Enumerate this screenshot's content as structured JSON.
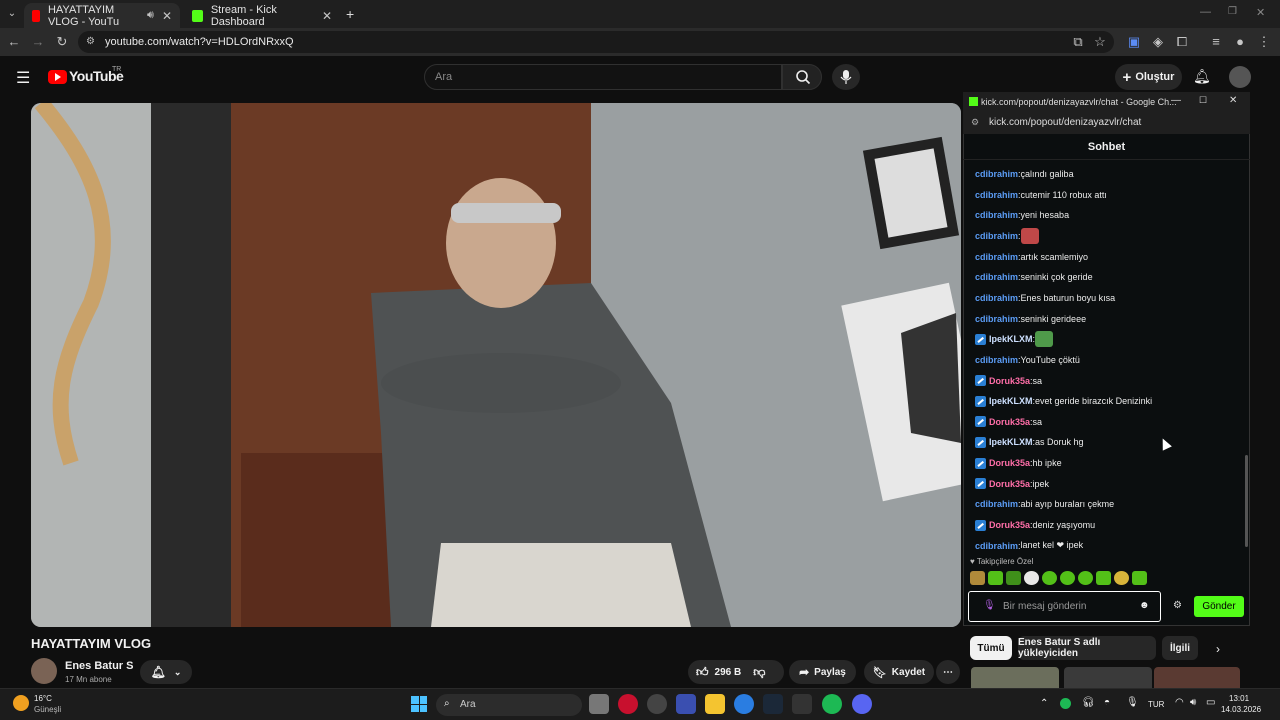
{
  "browser": {
    "tabs": [
      {
        "title": "HAYATTAYIM VLOG - YouTu",
        "active": true
      },
      {
        "title": "Stream - Kick Dashboard",
        "active": false
      }
    ],
    "url": "youtube.com/watch?v=HDLOrdNRxxQ"
  },
  "youtube": {
    "logo": "YouTube",
    "region": "TR",
    "search_placeholder": "Ara",
    "create_label": "Oluştur",
    "video_title": "HAYATTAYIM VLOG",
    "channel_name": "Enes Batur S",
    "subscribers": "17 Mn abone",
    "likes": "296 B",
    "share_label": "Paylaş",
    "save_label": "Kaydet",
    "filter_chips": [
      "Tümü",
      "Enes Batur S adlı yükleyiciden",
      "İlgili"
    ]
  },
  "popup": {
    "window_title": "kick.com/popout/denizayazvlr/chat - Google Ch...",
    "url": "kick.com/popout/denizayazvlr/chat",
    "header": "Sohbet",
    "messages": [
      {
        "user": "cdibrahim",
        "text": "çalındı galiba",
        "color": "#5b9cf5",
        "badge": false
      },
      {
        "user": "cdibrahim",
        "text": "cutemir 110 robux attı",
        "color": "#5b9cf5",
        "badge": false
      },
      {
        "user": "cdibrahim",
        "text": "yeni hesaba",
        "color": "#5b9cf5",
        "badge": false
      },
      {
        "user": "cdibrahim",
        "text": "",
        "color": "#5b9cf5",
        "badge": false,
        "emote": true
      },
      {
        "user": "cdibrahim",
        "text": "artık scamlemiyo",
        "color": "#5b9cf5",
        "badge": false
      },
      {
        "user": "cdibrahim",
        "text": "seninki çok geride",
        "color": "#5b9cf5",
        "badge": false
      },
      {
        "user": "cdibrahim",
        "text": "Enes baturun boyu kısa",
        "color": "#5b9cf5",
        "badge": false
      },
      {
        "user": "cdibrahim",
        "text": "seninki gerideee",
        "color": "#5b9cf5",
        "badge": false
      },
      {
        "user": "IpekKLXM",
        "text": "",
        "color": "#cde0ff",
        "badge": true,
        "emote": true
      },
      {
        "user": "cdibrahim",
        "text": "YouTube çöktü",
        "color": "#5b9cf5",
        "badge": false
      },
      {
        "user": "Doruk35a",
        "text": "sa",
        "color": "#ff6ea8",
        "badge": true
      },
      {
        "user": "IpekKLXM",
        "text": "evet geride birazcık Denizinki",
        "color": "#cde0ff",
        "badge": true
      },
      {
        "user": "Doruk35a",
        "text": "sa",
        "color": "#ff6ea8",
        "badge": true
      },
      {
        "user": "IpekKLXM",
        "text": "as Doruk hg",
        "color": "#cde0ff",
        "badge": true
      },
      {
        "user": "Doruk35a",
        "text": "hb ipke",
        "color": "#ff6ea8",
        "badge": true
      },
      {
        "user": "Doruk35a",
        "text": "ipek",
        "color": "#ff6ea8",
        "badge": true
      },
      {
        "user": "cdibrahim",
        "text": "abi ayıp buraları çekme",
        "color": "#5b9cf5",
        "badge": false
      },
      {
        "user": "Doruk35a",
        "text": "deniz yaşıyomu",
        "color": "#ff6ea8",
        "badge": true
      },
      {
        "user": "cdibrahim",
        "text": "lanet kel ❤ ipek",
        "color": "#5b9cf5",
        "badge": false
      }
    ],
    "followers_label": "♥ Takipçilere Özel",
    "input_placeholder": "Bir mesaj gönderin",
    "send_label": "Gönder"
  },
  "taskbar": {
    "weather_temp": "16°C",
    "weather_desc": "Güneşli",
    "search_label": "Ara",
    "language": "TUR",
    "time": "13:01",
    "date": "14.03.2026"
  }
}
